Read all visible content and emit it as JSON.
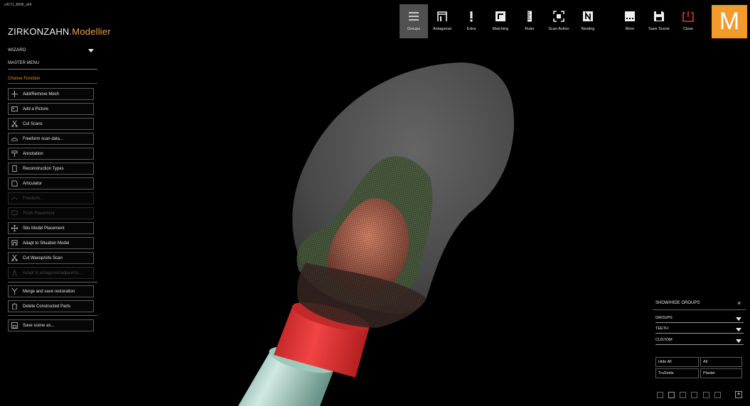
{
  "version": "v4171_8906_x64",
  "brand": {
    "part1": "ZIRKONZAHN",
    "part2": ".Modellier"
  },
  "wizard": {
    "label": "WIZARD"
  },
  "master_menu": {
    "label": "MASTER MENU"
  },
  "choose_function": {
    "label": "Choose Function"
  },
  "functions": [
    {
      "label": "Add/Remove Mesh",
      "icon": "plus-icon",
      "enabled": true
    },
    {
      "label": "Add a Picture",
      "icon": "picture-icon",
      "enabled": true
    },
    {
      "label": "Cut Scans",
      "icon": "scissors-icon",
      "enabled": true
    },
    {
      "label": "Freeform scan data...",
      "icon": "freeform-icon",
      "enabled": true
    },
    {
      "label": "Annotation",
      "icon": "annotation-pin-icon",
      "enabled": true
    },
    {
      "label": "Reconstruction Types",
      "icon": "reconstruction-icon",
      "enabled": true
    },
    {
      "label": "Articulator",
      "icon": "articulator-icon",
      "enabled": true
    },
    {
      "label": "Freeform...",
      "icon": "freeform-icon",
      "enabled": false
    },
    {
      "label": "Tooth Placement",
      "icon": "tooth-placement-icon",
      "enabled": false
    },
    {
      "label": "Situ Model Placement",
      "icon": "move-arrows-icon",
      "enabled": true
    },
    {
      "label": "Adapt to Situation Model",
      "icon": "adapt-model-icon",
      "enabled": true
    },
    {
      "label": "Cut Waxup/situ Scan",
      "icon": "scissors-icon",
      "enabled": true
    },
    {
      "label": "Adapt to antagonist/adjacents...",
      "icon": "antagonist-adapt-icon",
      "enabled": false
    },
    {
      "label": "Merge and save restoration",
      "icon": "merge-icon",
      "enabled": true
    },
    {
      "label": "Delete Constructed Parts",
      "icon": "trash-icon",
      "enabled": true
    },
    {
      "label": "Save scene as...",
      "icon": "save-scene-icon",
      "enabled": true
    }
  ],
  "toolbar": [
    {
      "label": "Groups",
      "icon": "groups-menu-icon",
      "active": true
    },
    {
      "label": "Antagonist",
      "icon": "antagonist-icon",
      "active": false
    },
    {
      "label": "Extra",
      "icon": "exclamation-icon",
      "active": false
    },
    {
      "label": "Matching",
      "icon": "matching-icon",
      "active": false
    },
    {
      "label": "Ruler",
      "icon": "ruler-icon",
      "active": false
    },
    {
      "label": "Scan Action",
      "icon": "scan-action-icon",
      "active": false
    },
    {
      "label": "Nesting",
      "icon": "nesting-n-icon",
      "active": false
    },
    {
      "label": "More",
      "icon": "more-icon",
      "active": false
    },
    {
      "label": "Save Scene",
      "icon": "floppy-disk-icon",
      "active": false
    },
    {
      "label": "Close",
      "icon": "power-close-icon",
      "active": false
    }
  ],
  "logo_letter": "M",
  "show_hide": {
    "title": "SHOW/HIDE GROUPS",
    "close": "×",
    "dropdowns": [
      "GROUPS",
      "TEETH",
      "CUSTOM"
    ],
    "buttons": [
      "Hide All",
      "All",
      "TruSmile",
      "Plaster"
    ]
  },
  "colors": {
    "accent": "#f29b2c",
    "brand_orange": "#f0a14a",
    "abutment_red": "#e53434",
    "implant": "#9ed1c4"
  }
}
